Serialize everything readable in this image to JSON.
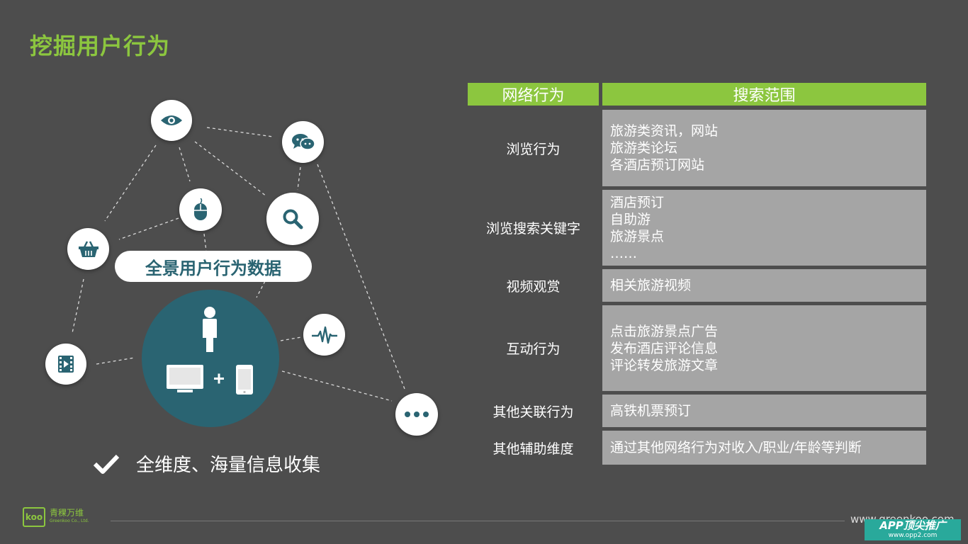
{
  "slide": {
    "title": "挖掘用户行为",
    "center_label": "全景用户行为数据",
    "bullet_text": "全维度、海量信息收集",
    "colors": {
      "accent": "#8cc63f",
      "teal": "#2a6472",
      "background": "#4d4d4d",
      "cell": "#a5a5a5"
    }
  },
  "icons": [
    "eye-icon",
    "chat-icon",
    "mouse-icon",
    "search-icon",
    "basket-icon",
    "video-icon",
    "pulse-icon",
    "more-icon",
    "person-icon",
    "monitor-icon",
    "phone-icon",
    "checkmark-icon"
  ],
  "table": {
    "headers": [
      "网络行为",
      "搜索范围"
    ],
    "rows": [
      {
        "behavior": "浏览行为",
        "scope": [
          "旅游类资讯，网站",
          "旅游类论坛",
          "各酒店预订网站"
        ]
      },
      {
        "behavior": "浏览搜索关键字",
        "scope": [
          "酒店预订",
          "自助游",
          "旅游景点",
          "……"
        ]
      },
      {
        "behavior": "视频观赏",
        "scope": [
          "相关旅游视频"
        ]
      },
      {
        "behavior": "互动行为",
        "scope": [
          "点击旅游景点广告",
          "发布酒店评论信息",
          "评论转发旅游文章"
        ]
      },
      {
        "behavior": "其他关联行为",
        "scope": [
          "高铁机票预订"
        ]
      },
      {
        "behavior": "其他辅助维度",
        "scope": [
          "通过其他网络行为对收入/职业/年龄等判断"
        ]
      }
    ]
  },
  "footer": {
    "logo_mark": "koo",
    "logo_cn": "青稞万维",
    "logo_en": "Greenkoo Co., Ltd.",
    "url": "www.greenkoo.com",
    "watermark_line1": "APP顶尖推广",
    "watermark_line2": "www.opp2.com"
  }
}
